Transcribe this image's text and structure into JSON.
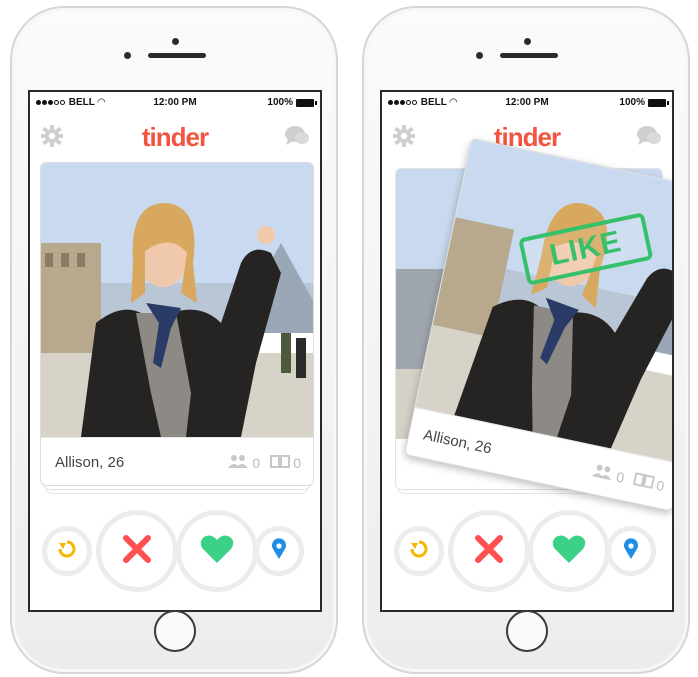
{
  "status": {
    "carrier": "BELL",
    "time": "12:00 PM",
    "battery": "100%"
  },
  "app": {
    "logo": "tinder",
    "accent": "#f2543f"
  },
  "nav_icons": {
    "left": "gear-icon",
    "right": "chat-bubble-icon"
  },
  "profile": {
    "name": "Allison, 26",
    "shared_friends": "0",
    "shared_interests": "0"
  },
  "stamp": {
    "text": "LIKE",
    "color": "#36c06a"
  },
  "actions": {
    "rewind": {
      "icon": "rewind-icon",
      "color": "#f5b800"
    },
    "nope": {
      "icon": "x-icon",
      "color": "#ff4f4f"
    },
    "like": {
      "icon": "heart-icon",
      "color": "#3ad186"
    },
    "boost": {
      "icon": "location-pin-icon",
      "color": "#1e8ee8"
    }
  }
}
